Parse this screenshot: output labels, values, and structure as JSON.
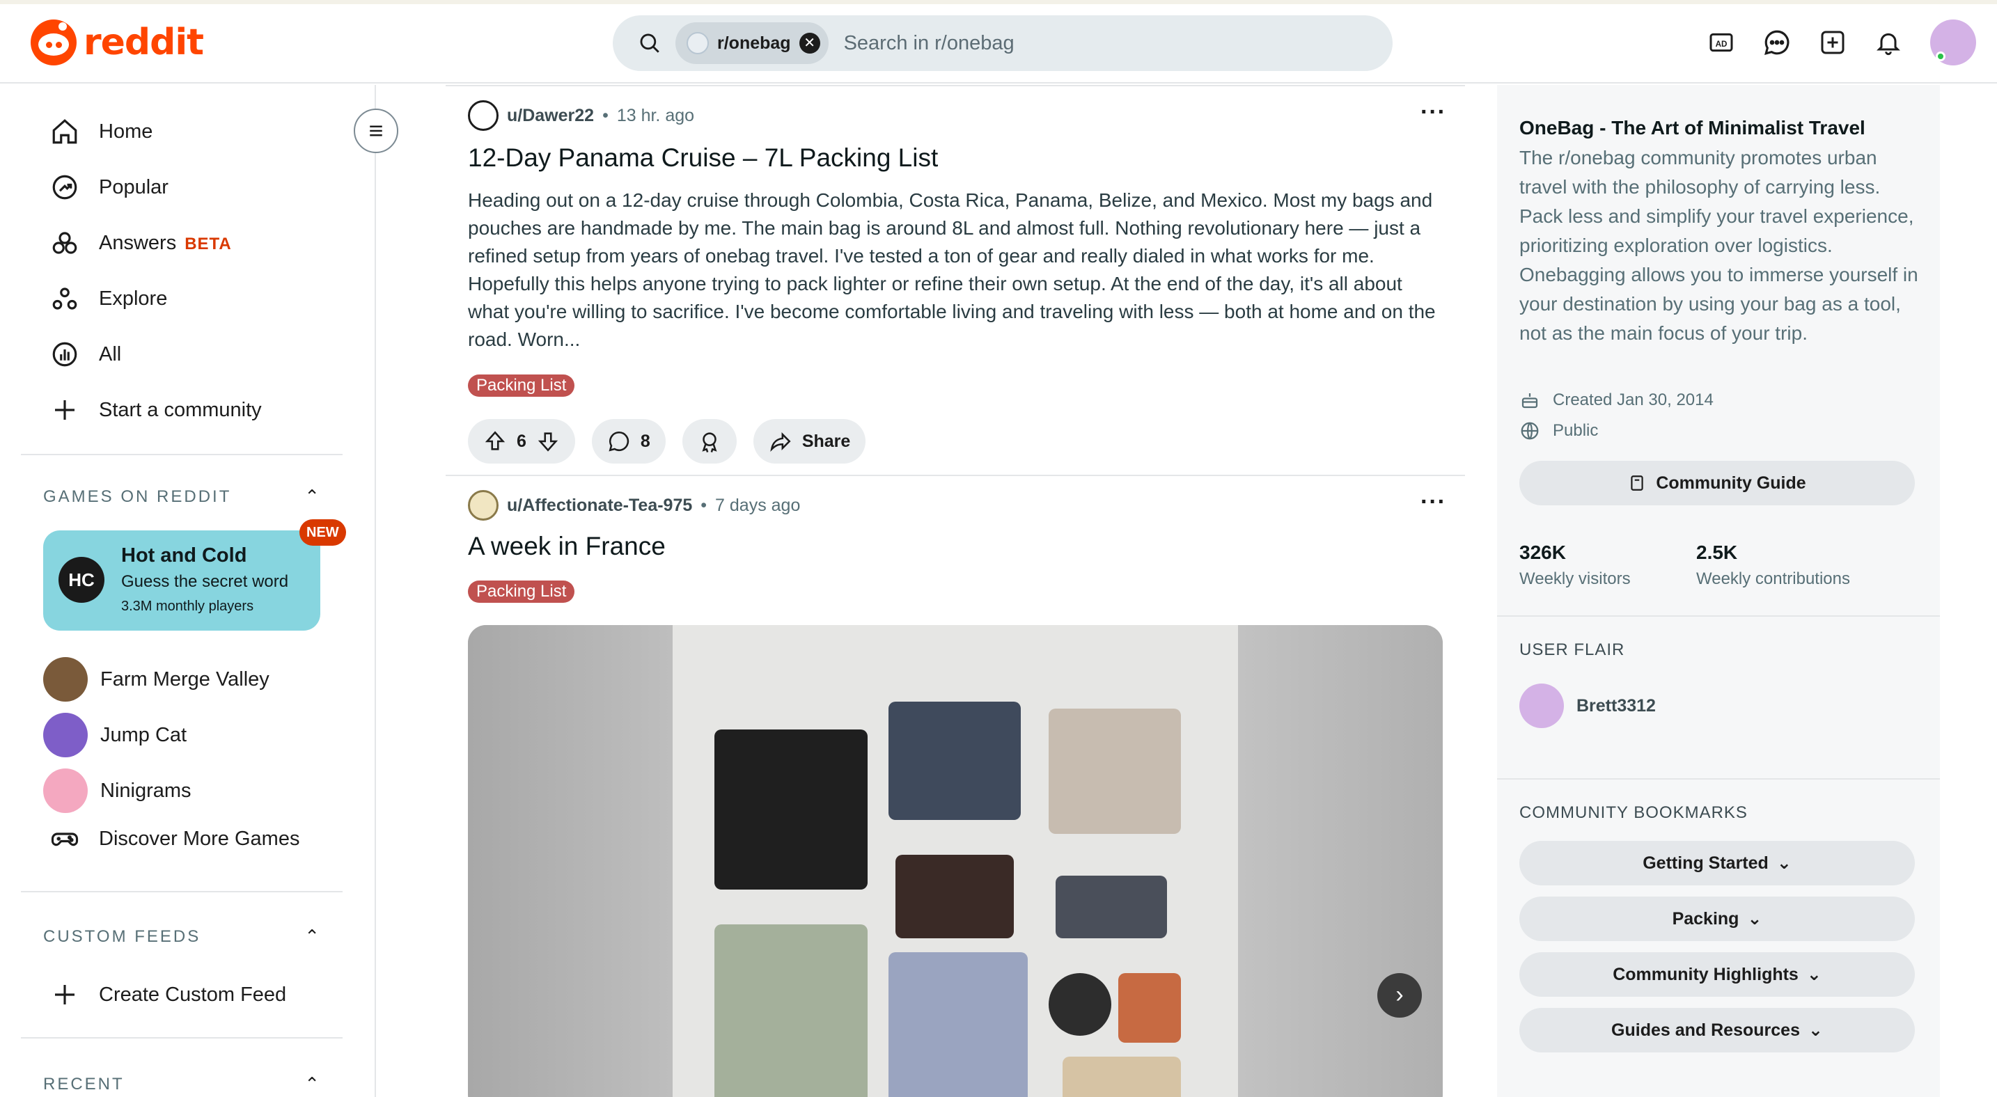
{
  "app": {
    "logo_text": "reddit",
    "brand_color": "#ff4500"
  },
  "search": {
    "chip_label": "r/onebag",
    "placeholder": "Search in r/onebag"
  },
  "header": {
    "icons": [
      "advertise-icon",
      "chat-icon",
      "create-post-icon",
      "notifications-icon",
      "user-avatar"
    ]
  },
  "sidebar": {
    "nav": [
      {
        "label": "Home",
        "icon": "home-icon"
      },
      {
        "label": "Popular",
        "icon": "popular-icon"
      },
      {
        "label": "Answers",
        "icon": "answers-icon",
        "badge": "BETA"
      },
      {
        "label": "Explore",
        "icon": "explore-icon"
      },
      {
        "label": "All",
        "icon": "all-icon"
      },
      {
        "label": "Start a community",
        "icon": "plus-icon"
      }
    ],
    "games_header": "GAMES ON REDDIT",
    "featured_game": {
      "title": "Hot and Cold",
      "subtitle": "Guess the secret word",
      "meta": "3.3M monthly players",
      "badge": "NEW",
      "logo_text": "HC"
    },
    "games": [
      {
        "label": "Farm Merge Valley"
      },
      {
        "label": "Jump Cat"
      },
      {
        "label": "Ninigrams"
      },
      {
        "label": "Discover More Games"
      }
    ],
    "custom_feeds_header": "CUSTOM FEEDS",
    "create_feed_label": "Create Custom Feed",
    "recent_header": "RECENT"
  },
  "posts": [
    {
      "author": "u/Dawer22",
      "time": "13 hr. ago",
      "title": "12-Day Panama Cruise – 7L Packing List",
      "body": "Heading out on a 12-day cruise through Colombia, Costa Rica, Panama, Belize, and Mexico. Most my bags and pouches are handmade by me. The main bag is around 8L and almost full. Nothing revolutionary here — just a refined setup from years of onebag travel. I've tested a ton of gear and really dialed in what works for me. Hopefully this helps anyone trying to pack lighter or refine their own setup. At the end of the day, it's all about what you're willing to sacrifice. I've become comfortable living and traveling with less — both at home and on the road. Worn...",
      "flair": "Packing List",
      "upvotes": "6",
      "comments": "8",
      "share_label": "Share"
    },
    {
      "author": "u/Affectionate-Tea-975",
      "time": "7 days ago",
      "title": "A week in France",
      "flair": "Packing List"
    }
  ],
  "community": {
    "title": "OneBag - The Art of Minimalist Travel",
    "description": "The r/onebag community promotes urban travel with the philosophy of carrying less. Pack less and simplify your travel experience, prioritizing exploration over logistics. Onebagging allows you to immerse yourself in your destination by using your bag as a tool, not as the main focus of your trip.",
    "created": "Created Jan 30, 2014",
    "visibility": "Public",
    "guide_label": "Community Guide",
    "stats": [
      {
        "value": "326K",
        "label": "Weekly visitors"
      },
      {
        "value": "2.5K",
        "label": "Weekly contributions"
      }
    ],
    "user_flair_header": "USER FLAIR",
    "user_flair_name": "Brett3312",
    "bookmarks_header": "COMMUNITY BOOKMARKS",
    "bookmarks": [
      "Getting Started",
      "Packing",
      "Community Highlights",
      "Guides and Resources"
    ]
  }
}
